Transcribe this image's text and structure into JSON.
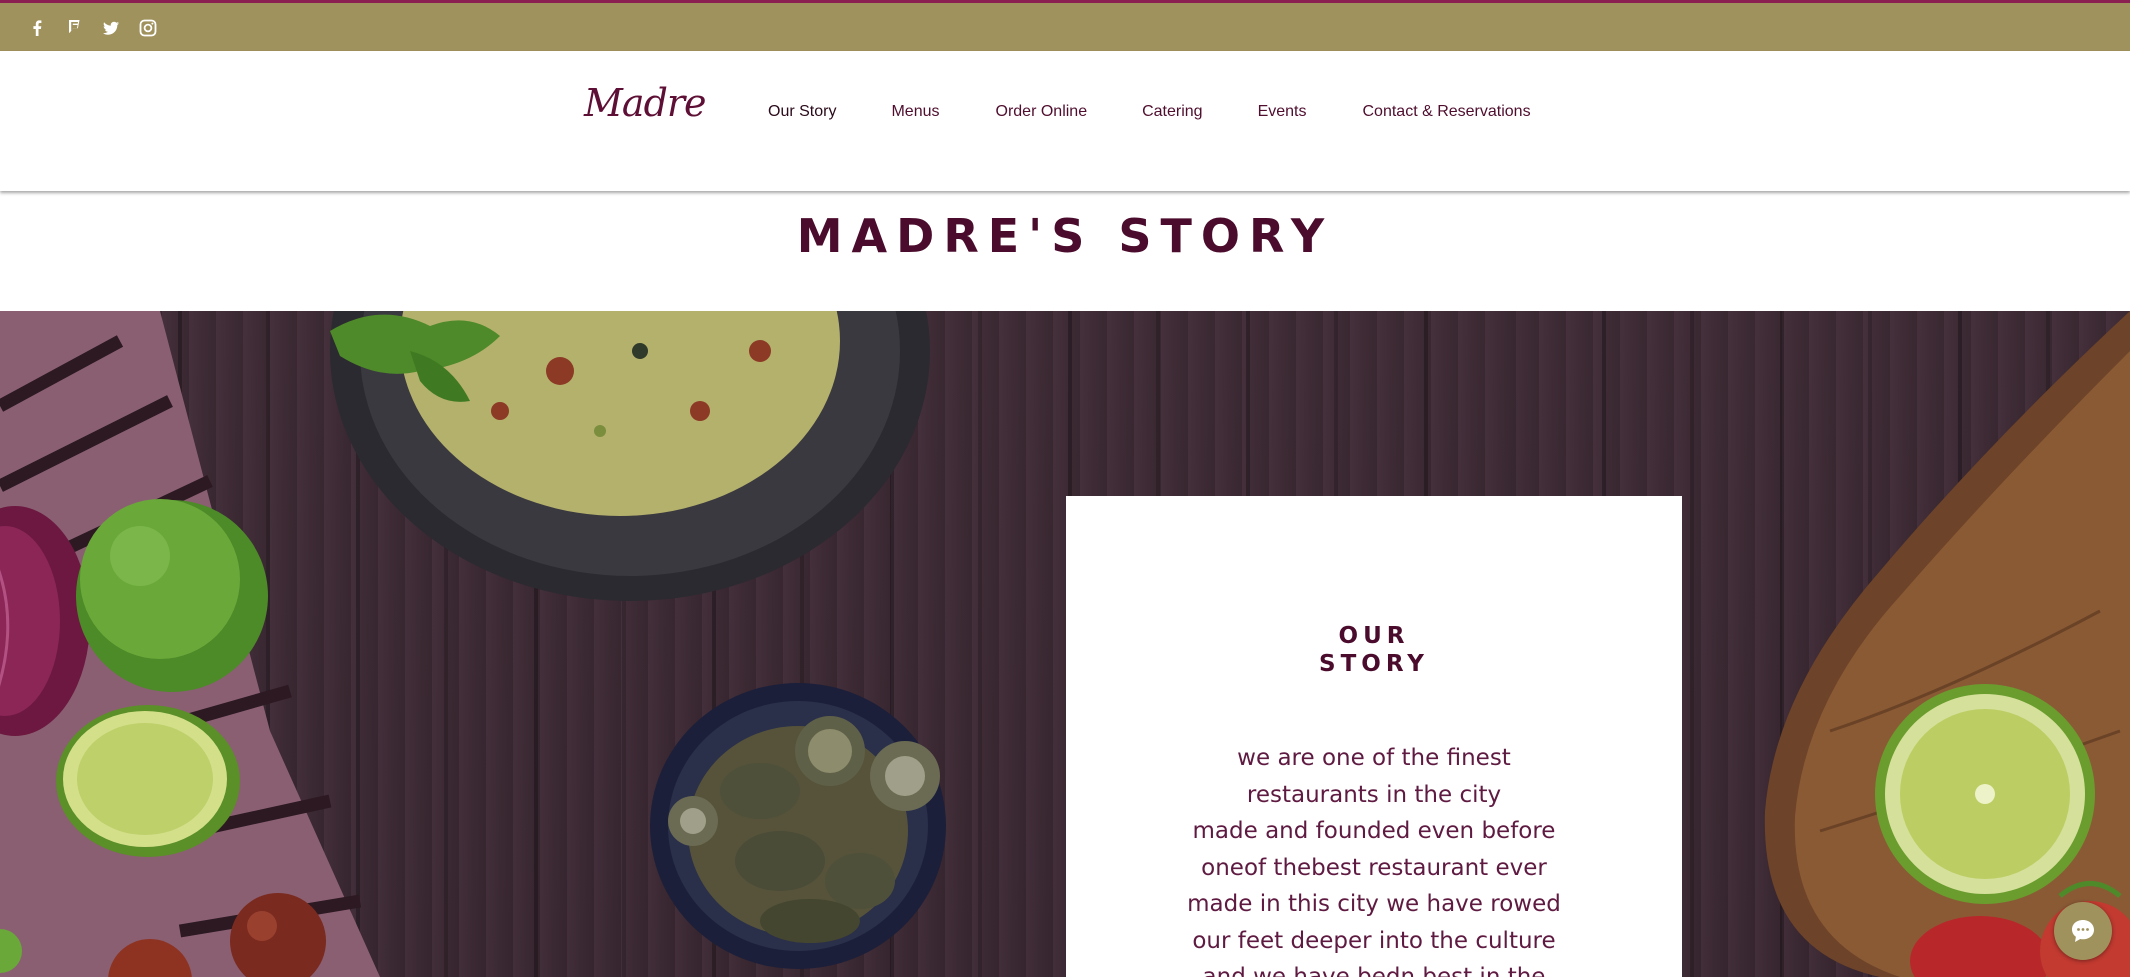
{
  "social": {
    "icons": [
      "facebook-icon",
      "foursquare-icon",
      "twitter-icon",
      "instagram-icon"
    ]
  },
  "header": {
    "logo": "Madre",
    "nav": [
      {
        "label": "Our Story",
        "current": true
      },
      {
        "label": "Menus",
        "current": false
      },
      {
        "label": "Order Online",
        "current": false
      },
      {
        "label": "Catering",
        "current": false
      },
      {
        "label": "Events",
        "current": false
      },
      {
        "label": "Contact & Reservations",
        "current": false
      }
    ]
  },
  "page": {
    "title": "MADRE'S STORY"
  },
  "story": {
    "heading_line1": "OUR",
    "heading_line2": "STORY",
    "lines": [
      "we are one of the finest",
      "restaurants in the city",
      "made and founded even before",
      "oneof thebest restaurant ever",
      "made in this city we have rowed",
      "our feet deeper into the culture",
      "and we have bedn best in the"
    ]
  },
  "chat": {
    "icon": "chat-bubble-icon"
  },
  "colors": {
    "accent_bar": "#a0925d",
    "brand": "#4a0b2c",
    "top_border": "#8c1f52"
  }
}
